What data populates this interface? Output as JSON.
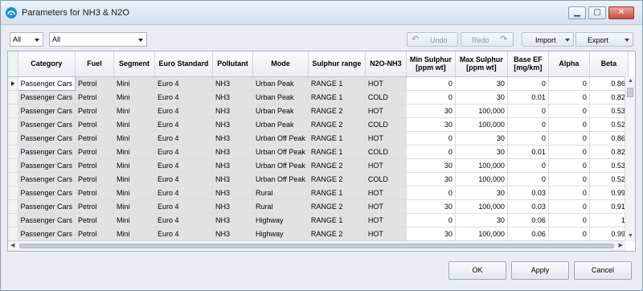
{
  "window": {
    "title": "Parameters for NH3 & N2O"
  },
  "toolbar": {
    "filter1": "All",
    "filter2": "All",
    "undo_label": "Undo",
    "redo_label": "Redo",
    "import_label": "Import",
    "export_label": "Export"
  },
  "table": {
    "columns": [
      "Category",
      "Fuel",
      "Segment",
      "Euro Standard",
      "Pollutant",
      "Mode",
      "Sulphur range",
      "N2O-NH3",
      "Min Sulphur [ppm wt]",
      "Max Sulphur [ppm wt]",
      "Base EF [mg/km]",
      "Alpha",
      "Beta"
    ],
    "rows": [
      [
        "Passenger Cars",
        "Petrol",
        "Mini",
        "Euro 4",
        "NH3",
        "Urban Peak",
        "RANGE 1",
        "HOT",
        "0",
        "30",
        "0",
        "0",
        "0.86"
      ],
      [
        "Passenger Cars",
        "Petrol",
        "Mini",
        "Euro 4",
        "NH3",
        "Urban Peak",
        "RANGE 1",
        "COLD",
        "0",
        "30",
        "0.01",
        "0",
        "0.82"
      ],
      [
        "Passenger Cars",
        "Petrol",
        "Mini",
        "Euro 4",
        "NH3",
        "Urban Peak",
        "RANGE 2",
        "HOT",
        "30",
        "100,000",
        "0",
        "0",
        "0.53"
      ],
      [
        "Passenger Cars",
        "Petrol",
        "Mini",
        "Euro 4",
        "NH3",
        "Urban Peak",
        "RANGE 2",
        "COLD",
        "30",
        "100,000",
        "0",
        "0",
        "0.52"
      ],
      [
        "Passenger Cars",
        "Petrol",
        "Mini",
        "Euro 4",
        "NH3",
        "Urban Off Peak",
        "RANGE 1",
        "HOT",
        "0",
        "30",
        "0",
        "0",
        "0.86"
      ],
      [
        "Passenger Cars",
        "Petrol",
        "Mini",
        "Euro 4",
        "NH3",
        "Urban Off Peak",
        "RANGE 1",
        "COLD",
        "0",
        "30",
        "0.01",
        "0",
        "0.82"
      ],
      [
        "Passenger Cars",
        "Petrol",
        "Mini",
        "Euro 4",
        "NH3",
        "Urban Off Peak",
        "RANGE 2",
        "HOT",
        "30",
        "100,000",
        "0",
        "0",
        "0.53"
      ],
      [
        "Passenger Cars",
        "Petrol",
        "Mini",
        "Euro 4",
        "NH3",
        "Urban Off Peak",
        "RANGE 2",
        "COLD",
        "30",
        "100,000",
        "0",
        "0",
        "0.52"
      ],
      [
        "Passenger Cars",
        "Petrol",
        "Mini",
        "Euro 4",
        "NH3",
        "Rural",
        "RANGE 1",
        "HOT",
        "0",
        "30",
        "0.03",
        "0",
        "0.99"
      ],
      [
        "Passenger Cars",
        "Petrol",
        "Mini",
        "Euro 4",
        "NH3",
        "Rural",
        "RANGE 2",
        "HOT",
        "30",
        "100,000",
        "0.03",
        "0",
        "0.91"
      ],
      [
        "Passenger Cars",
        "Petrol",
        "Mini",
        "Euro 4",
        "NH3",
        "Highway",
        "RANGE 1",
        "HOT",
        "0",
        "30",
        "0.06",
        "0",
        "1"
      ],
      [
        "Passenger Cars",
        "Petrol",
        "Mini",
        "Euro 4",
        "NH3",
        "Highway",
        "RANGE 2",
        "HOT",
        "30",
        "100,000",
        "0.06",
        "0",
        "0.99"
      ]
    ]
  },
  "footer": {
    "ok_label": "OK",
    "apply_label": "Apply",
    "cancel_label": "Cancel"
  }
}
